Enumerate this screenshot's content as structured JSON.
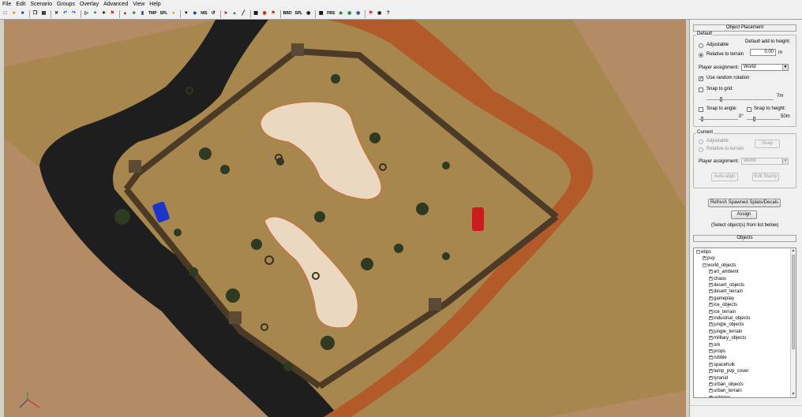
{
  "menu": [
    "File",
    "Edit",
    "Scenario",
    "Groups",
    "Overlay",
    "Advanced",
    "View",
    "Help"
  ],
  "toolbar": {
    "text_buttons": [
      "TMP",
      "SPL",
      "NIS",
      "BBD",
      "SPL",
      "FBS"
    ],
    "icons": [
      "new-file",
      "open-folder",
      "save",
      "copy",
      "paste",
      "delete",
      "undo",
      "redo",
      "select",
      "move",
      "flag",
      "terrain",
      "bulb",
      "shovel",
      "splat",
      "undo-arrow",
      "paint",
      "red-arrow",
      "grid",
      "lock",
      "camera",
      "help"
    ]
  },
  "panel": {
    "placement_title": "Object Placement",
    "default_group": "Default",
    "adjustable": "Adjustable",
    "relative": "Relative to terrain",
    "default_height_label": "Default add to height:",
    "default_height_value": "0.00",
    "height_unit": "m",
    "player_label": "Player assignment:",
    "player_value": "World",
    "random_rotation": "Use random rotation",
    "snap_grid": "Snap to grid:",
    "grid_max": "7m",
    "snap_angle": "Snap to angle:",
    "angle_min": "0°",
    "snap_height": "Snap to height:",
    "height_max": "50m",
    "current_group": "Current",
    "cur_adjustable": "Adjustable",
    "cur_relative": "Relative to terrain",
    "snap_button": "Snap",
    "cur_player_label": "Player assignment:",
    "cur_player_value": "World",
    "autoalign_button": "Auto-align",
    "edit_stamp_button": "Edit Stamp",
    "refresh_button": "Refresh Spawned Splats/Decals",
    "assign_button": "Assign",
    "assign_hint": "(Select object(s) from list below)",
    "objects_title": "Objects"
  },
  "tree": [
    {
      "label": "ebps",
      "indent": 0
    },
    {
      "label": "pvp",
      "indent": 1
    },
    {
      "label": "world_objects",
      "indent": 1
    },
    {
      "label": "art_ambient",
      "indent": 2
    },
    {
      "label": "chaos",
      "indent": 2
    },
    {
      "label": "desert_objects",
      "indent": 2
    },
    {
      "label": "desert_terrain",
      "indent": 2
    },
    {
      "label": "gameplay",
      "indent": 2
    },
    {
      "label": "ice_objects",
      "indent": 2
    },
    {
      "label": "ice_terrain",
      "indent": 2
    },
    {
      "label": "industrial_objects",
      "indent": 2
    },
    {
      "label": "jungle_objects",
      "indent": 2
    },
    {
      "label": "jungle_terrain",
      "indent": 2
    },
    {
      "label": "military_objects",
      "indent": 2
    },
    {
      "label": "ork",
      "indent": 2
    },
    {
      "label": "props",
      "indent": 2
    },
    {
      "label": "rubble",
      "indent": 2
    },
    {
      "label": "spacehulk",
      "indent": 2
    },
    {
      "label": "temp_pvp_cover",
      "indent": 2
    },
    {
      "label": "tyranid",
      "indent": 2
    },
    {
      "label": "urban_objects",
      "indent": 2
    },
    {
      "label": "urban_terrain",
      "indent": 2
    },
    {
      "label": "vehicles",
      "indent": 2
    }
  ],
  "colors": {
    "ground": "#b38c65",
    "sand": "#a8874e",
    "river": "#1e1e1e",
    "canyon": "#b35a2a",
    "player1": "#1e35c8",
    "player2": "#c81e1e"
  }
}
